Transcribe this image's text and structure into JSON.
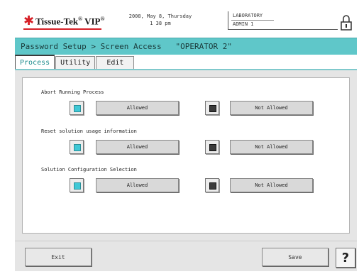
{
  "header": {
    "brand_name": "Tissue-Tek",
    "brand_suffix": "VIP",
    "datetime_line1": "2008, May 8, Thursday",
    "datetime_line2": "1 38 pm",
    "location": "LABORATORY",
    "user": "ADMIN 1"
  },
  "titlebar": {
    "text": "Password Setup > Screen Access   \"OPERATOR 2\""
  },
  "tabs": [
    {
      "label": "Process",
      "active": true
    },
    {
      "label": "Utility",
      "active": false
    },
    {
      "label": "Edit",
      "active": false
    }
  ],
  "permissions": [
    {
      "label": "Abort Running Process",
      "allowed_label": "Allowed",
      "not_allowed_label": "Not Allowed",
      "selected": "allowed"
    },
    {
      "label": "Reset solution usage information",
      "allowed_label": "Allowed",
      "not_allowed_label": "Not Allowed",
      "selected": "allowed"
    },
    {
      "label": "Solution Configuration Selection",
      "allowed_label": "Allowed",
      "not_allowed_label": "Not Allowed",
      "selected": "allowed"
    }
  ],
  "footer": {
    "exit_label": "Exit",
    "save_label": "Save",
    "help_label": "?"
  },
  "colors": {
    "accent": "#5fc7c9",
    "selected_indicator": "#3fc8d6",
    "brand_red": "#d61f26"
  }
}
